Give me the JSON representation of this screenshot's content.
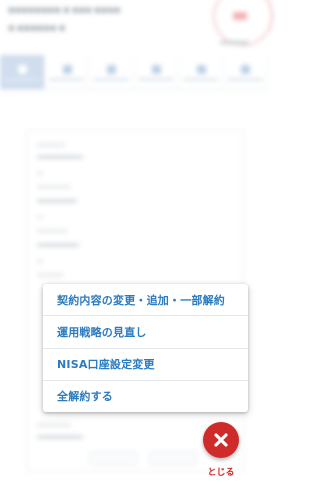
{
  "background": {
    "header": {
      "user_line": "■■■■■■■■  ■ ■■■ ■■■■",
      "sub_line": "■ ■■■■■■  ■",
      "logout_caption": "■■■■■■"
    },
    "tabs": [
      {
        "icon": "home-icon",
        "active": true
      },
      {
        "icon": "document-icon",
        "active": false
      },
      {
        "icon": "chart-icon",
        "active": false
      },
      {
        "icon": "settings-icon",
        "active": false
      },
      {
        "icon": "people-icon",
        "active": false
      },
      {
        "icon": "mail-icon",
        "active": false
      }
    ]
  },
  "menu": {
    "items": [
      {
        "label": "契約内容の変更・追加・一部解約"
      },
      {
        "label": "運用戦略の見直し"
      },
      {
        "label": "NISA口座設定変更"
      },
      {
        "label": "全解約する"
      }
    ]
  },
  "close": {
    "label": "とじる"
  },
  "colors": {
    "accent": "#2a7bc0",
    "close": "#cf2b2b",
    "active_tab": "#c2d4e9"
  }
}
